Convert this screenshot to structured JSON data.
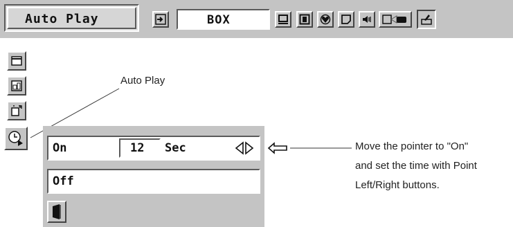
{
  "menu": {
    "title": "Auto Play",
    "field_value": "BOX"
  },
  "toolbar_icons": [
    "enter-icon",
    "screen-icon",
    "picture-frame-icon",
    "color-heart-icon",
    "image-adjust-icon",
    "speaker-icon",
    "projector-icon",
    "setting-icon"
  ],
  "side_icons": [
    "window-icon",
    "picture-icon",
    "move-icon",
    "clock-icon"
  ],
  "panel": {
    "on_label": "On",
    "seconds_value": "12",
    "unit_label": "Sec",
    "off_label": "Off",
    "exit_icon": "door-exit-icon",
    "arrows_icon": "left-right-arrows-icon",
    "pointer_icon": "pointer-hand-icon"
  },
  "annotations": {
    "auto_play_callout": "Auto Play",
    "instruction_line1": "Move the pointer to \"On\"",
    "instruction_line2": "and set the time with Point",
    "instruction_line3": "Left/Right buttons."
  }
}
